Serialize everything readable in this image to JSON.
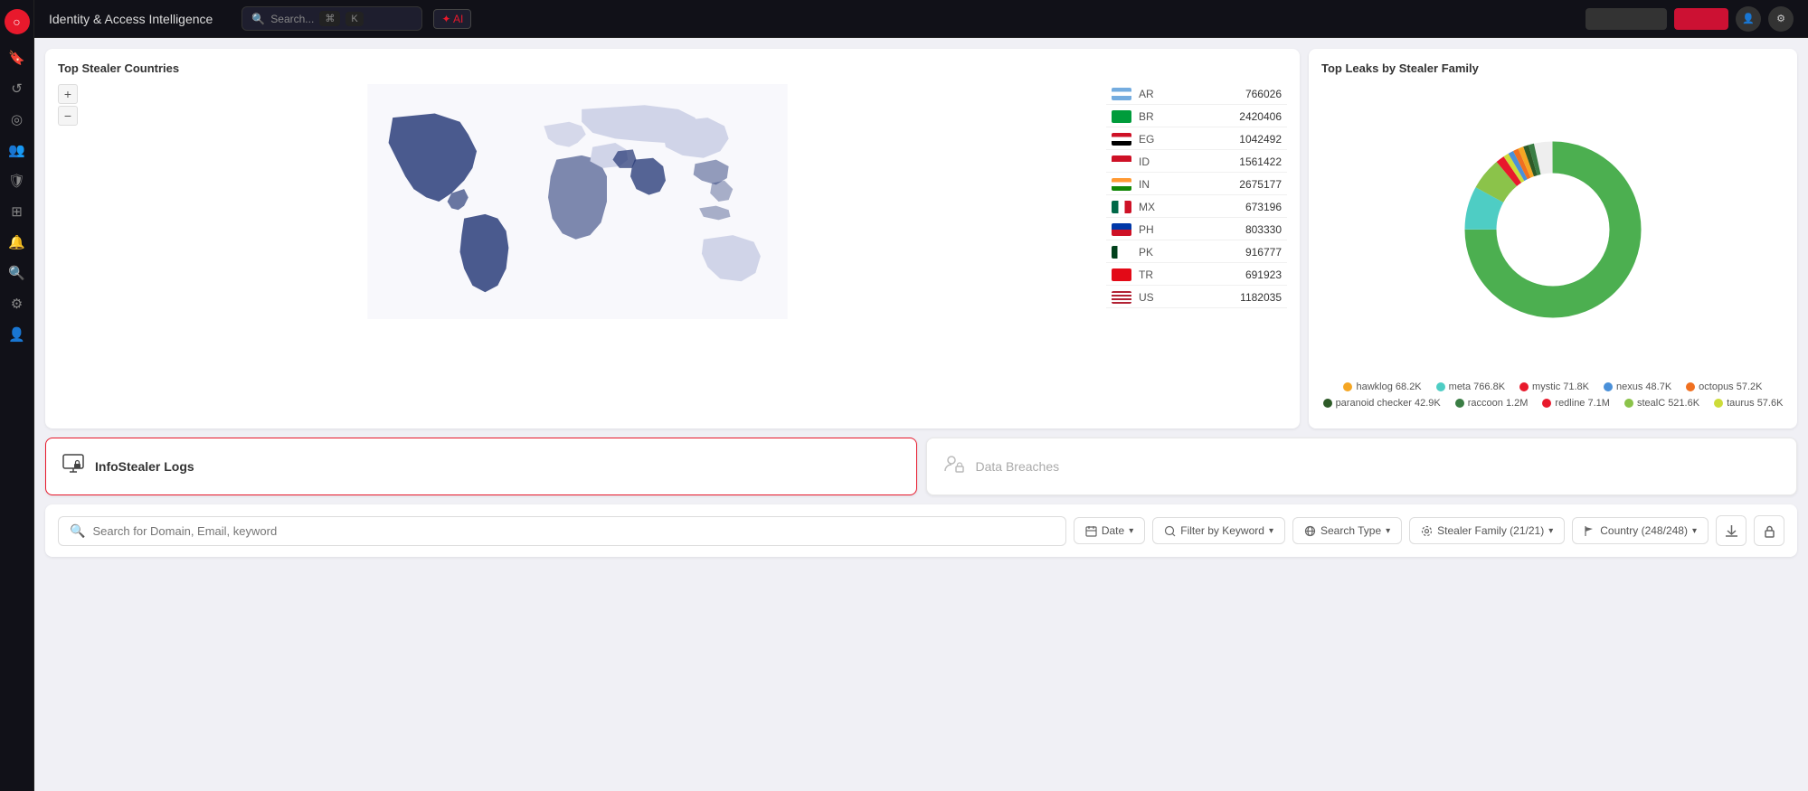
{
  "app": {
    "title": "Identity & Access Intelligence",
    "search_placeholder": "Search..."
  },
  "sidebar": {
    "icons": [
      {
        "name": "logo",
        "symbol": "○"
      },
      {
        "name": "bookmark",
        "symbol": "🔖"
      },
      {
        "name": "refresh",
        "symbol": "↺"
      },
      {
        "name": "target",
        "symbol": "◎"
      },
      {
        "name": "users",
        "symbol": "👥"
      },
      {
        "name": "shield",
        "symbol": "🛡"
      },
      {
        "name": "layers",
        "symbol": "⊞"
      },
      {
        "name": "bell",
        "symbol": "🔔"
      },
      {
        "name": "search-circle",
        "symbol": "🔍"
      },
      {
        "name": "gear",
        "symbol": "⚙"
      },
      {
        "name": "user-tag",
        "symbol": "👤"
      }
    ]
  },
  "map_panel": {
    "title": "Top Stealer Countries",
    "countries": [
      {
        "code": "AR",
        "flag_class": "flag-ar",
        "count": "766026"
      },
      {
        "code": "BR",
        "flag_class": "flag-br",
        "count": "2420406"
      },
      {
        "code": "EG",
        "flag_class": "flag-eg",
        "count": "1042492"
      },
      {
        "code": "ID",
        "flag_class": "flag-id",
        "count": "1561422"
      },
      {
        "code": "IN",
        "flag_class": "flag-in",
        "count": "2675177"
      },
      {
        "code": "MX",
        "flag_class": "flag-mx",
        "count": "673196"
      },
      {
        "code": "PH",
        "flag_class": "flag-ph",
        "count": "803330"
      },
      {
        "code": "PK",
        "flag_class": "flag-pk",
        "count": "916777"
      },
      {
        "code": "TR",
        "flag_class": "flag-tr",
        "count": "691923"
      },
      {
        "code": "US",
        "flag_class": "flag-us",
        "count": "1182035"
      }
    ]
  },
  "donut_panel": {
    "title": "Top Leaks by Stealer Family",
    "legend": [
      {
        "label": "hawklog",
        "value": "68.2K",
        "color": "#f5a623"
      },
      {
        "label": "meta",
        "value": "766.8K",
        "color": "#4ecdc4"
      },
      {
        "label": "mystic",
        "value": "71.8K",
        "color": "#e8192c"
      },
      {
        "label": "nexus",
        "value": "48.7K",
        "color": "#4a90d9"
      },
      {
        "label": "octopus",
        "value": "57.2K",
        "color": "#f07020"
      },
      {
        "label": "paranoid checker",
        "value": "42.9K",
        "color": "#2d5a27"
      },
      {
        "label": "raccoon",
        "value": "1.2M",
        "color": "#3a7d44"
      },
      {
        "label": "redline",
        "value": "7.1M",
        "color": "#e8192c"
      },
      {
        "label": "stealC",
        "value": "521.6K",
        "color": "#8bc34a"
      },
      {
        "label": "taurus",
        "value": "57.6K",
        "color": "#cddc39"
      }
    ],
    "segments": [
      {
        "color": "#4ecdc4",
        "pct": 8
      },
      {
        "color": "#e8192c",
        "pct": 1
      },
      {
        "color": "#f07020",
        "pct": 1
      },
      {
        "color": "#4a90d9",
        "pct": 1
      },
      {
        "color": "#2d5a27",
        "pct": 1
      },
      {
        "color": "#3a7d44",
        "pct": 1
      },
      {
        "color": "#e83030",
        "pct": 75
      },
      {
        "color": "#8bc34a",
        "pct": 6
      },
      {
        "color": "#cddc39",
        "pct": 1
      },
      {
        "color": "#f5a623",
        "pct": 1
      },
      {
        "color": "#e0e0e0",
        "pct": 4
      }
    ]
  },
  "tabs": {
    "infostealer": {
      "label": "InfoStealer Logs"
    },
    "databreaches": {
      "label": "Data Breaches"
    }
  },
  "search_bar": {
    "placeholder": "Search for Domain, Email, keyword",
    "filters": [
      {
        "id": "date",
        "label": "Date",
        "icon": "calendar"
      },
      {
        "id": "keyword",
        "label": "Filter by Keyword",
        "icon": "filter"
      },
      {
        "id": "search_type",
        "label": "Search Type",
        "icon": "globe"
      },
      {
        "id": "stealer_family",
        "label": "Stealer Family (21/21)",
        "icon": "gear"
      },
      {
        "id": "country",
        "label": "Country (248/248)",
        "icon": "flag"
      }
    ]
  }
}
